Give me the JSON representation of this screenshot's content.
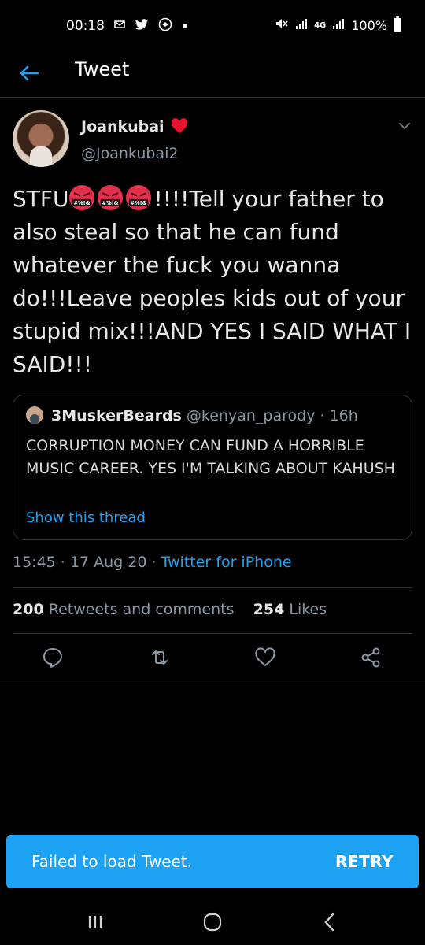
{
  "status_bar": {
    "time": "00:18",
    "left_icons": [
      "mail-icon",
      "twitter-icon",
      "browser-icon",
      "dot-icon"
    ],
    "right_icons": [
      "mute-icon",
      "signal-icon",
      "4g-icon",
      "signal-icon"
    ],
    "network": "4G",
    "battery": "100%"
  },
  "header": {
    "title": "Tweet"
  },
  "tweet": {
    "display_name": "Joankubai",
    "handle": "@Joankubai2",
    "text_lead": "STFU",
    "text_body": "!!!!Tell your father to also steal so that he can fund whatever the fuck you wanna do!!!Leave peoples kids out of your stupid mix!!!AND YES I SAID WHAT I SAID!!!",
    "timestamp": "15:45 · 17 Aug 20 · ",
    "source": "Twitter for iPhone",
    "retweets_count": "200",
    "retweets_label": "Retweets and comments",
    "likes_count": "254",
    "likes_label": "Likes"
  },
  "quote": {
    "name": "3MuskerBeards",
    "handle": "@kenyan_parody",
    "age": "· 16h",
    "text": "CORRUPTION MONEY CAN FUND A HORRIBLE MUSIC CAREER. YES I'M TALKING ABOUT KAHUSH",
    "thread_link": "Show this thread"
  },
  "snackbar": {
    "message": "Failed to load Tweet.",
    "action": "RETRY"
  },
  "colors": {
    "background": "#000000",
    "accent": "#1da1f2",
    "secondary_text": "#8b98a5",
    "divider": "#2f3336"
  }
}
